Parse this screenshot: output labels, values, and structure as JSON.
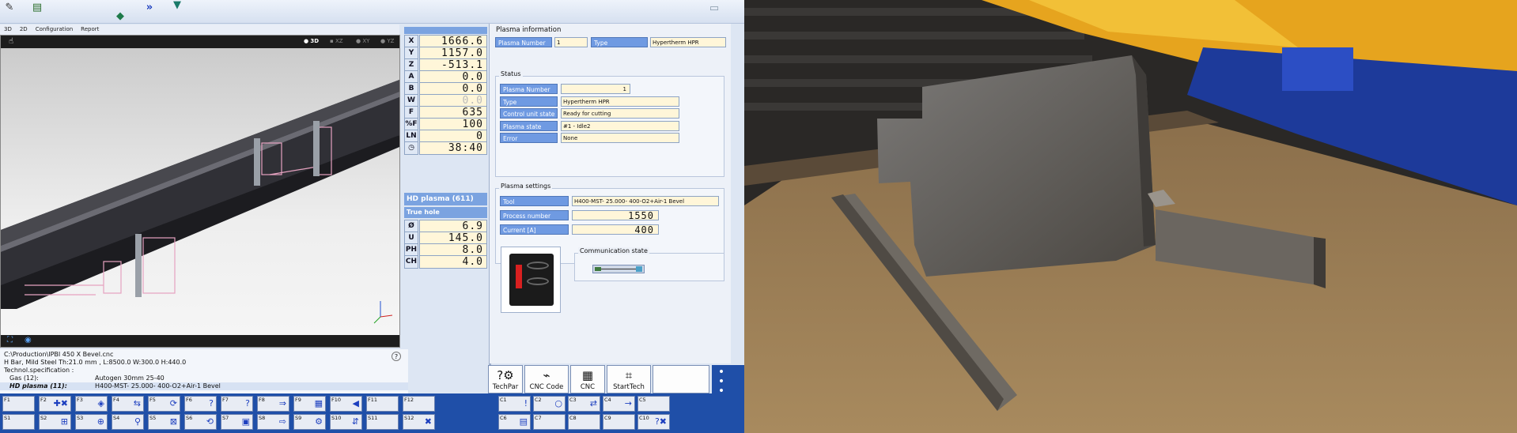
{
  "toolbar": {
    "icons": [
      "edit-icon",
      "document-icon",
      "layers-icon",
      "forward-icon",
      "torch-icon",
      "chat-icon"
    ]
  },
  "tabs": [
    "3D",
    "2D",
    "Configuration",
    "Report"
  ],
  "view": {
    "modes": [
      "3D",
      "XZ",
      "XY",
      "YZ"
    ]
  },
  "dro": [
    {
      "axis": "X",
      "value": "1666.6"
    },
    {
      "axis": "Y",
      "value": "1157.0"
    },
    {
      "axis": "Z",
      "value": "-513.1"
    },
    {
      "axis": "A",
      "value": "0.0"
    },
    {
      "axis": "B",
      "value": "0.0"
    },
    {
      "axis": "W",
      "value": "0.0"
    },
    {
      "axis": "F",
      "value": "635"
    },
    {
      "axis": "%F",
      "value": "100"
    },
    {
      "axis": "LN",
      "value": "0"
    },
    {
      "axis": "clock-icon",
      "value": "38:40"
    }
  ],
  "process": {
    "header": "HD plasma (611)",
    "subheader": "True hole",
    "rows": [
      {
        "label": "Ø",
        "value": "6.9"
      },
      {
        "label": "U",
        "value": "145.0"
      },
      {
        "label": "PH",
        "value": "8.0"
      },
      {
        "label": "CH",
        "value": "4.0"
      }
    ]
  },
  "plasma_info": {
    "title": "Plasma information",
    "number_label": "Plasma Number",
    "number_value": "1",
    "type_label": "Type",
    "type_value": "Hypertherm HPR"
  },
  "status": {
    "title": "Status",
    "fields": [
      {
        "label": "Plasma Number",
        "value": "1"
      },
      {
        "label": "Type",
        "value": "Hypertherm HPR"
      },
      {
        "label": "Control unit state",
        "value": "Ready for cutting"
      },
      {
        "label": "Plasma state",
        "value": "#1 - Idle2"
      },
      {
        "label": "Error",
        "value": "None"
      }
    ]
  },
  "settings": {
    "title": "Plasma settings",
    "tool_label": "Tool",
    "tool_value": "H400-MST- 25.000- 400-O2+Air-1 Bevel",
    "process_label": "Process number",
    "process_value": "1550",
    "current_label": "Current [A]",
    "current_value": "400"
  },
  "communication": {
    "title": "Communication state"
  },
  "bottom_info": {
    "path": "C:\\Production\\IPBI 450  X Bevel.cnc",
    "line2": "H Bar, Mild Steel Th:21.0 mm , L:8500.0  W:300.0  H:440.0",
    "line3": "Technol.specification :",
    "gas_label": "Gas (12):",
    "gas_value": "Autogen 30mm 25-40",
    "plasma_label": "HD plasma (11):",
    "plasma_value": "H400-MST- 25.000- 400-O2+Air-1 Bevel"
  },
  "big_buttons": [
    "TechPar",
    "CNC Code",
    "CNC",
    "StartTech"
  ],
  "fkeys_row1": [
    "F1",
    "F2",
    "F3",
    "F4",
    "F5",
    "F6",
    "F7",
    "F8",
    "F9",
    "F10",
    "F11",
    "F12"
  ],
  "fkeys_row2": [
    "S1",
    "S2",
    "S3",
    "S4",
    "S5",
    "S6",
    "S7",
    "S8",
    "S9",
    "S10",
    "S11",
    "S12"
  ],
  "ckeys_row1": [
    "C1",
    "C2",
    "C3",
    "C4",
    "C5"
  ],
  "ckeys_row2": [
    "C6",
    "C7",
    "C8",
    "C9",
    "C10"
  ],
  "colors": {
    "accent": "#6f9ae2",
    "field_bg": "#fff6d9",
    "fkey_bar": "#1f4fa8"
  }
}
